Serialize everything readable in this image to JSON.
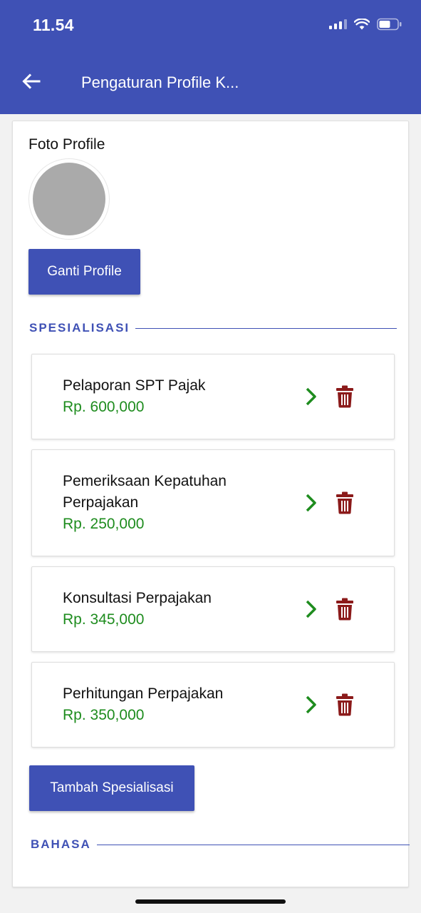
{
  "status_bar": {
    "time": "11.54"
  },
  "app_bar": {
    "title": "Pengaturan Profile K..."
  },
  "profile": {
    "photo_label": "Foto Profile",
    "change_button": "Ganti Profile"
  },
  "specializations": {
    "section_title": "SPESIALISASI",
    "items": [
      {
        "name": "Pelaporan SPT Pajak",
        "price": "Rp. 600,000"
      },
      {
        "name": "Pemeriksaan Kepatuhan Perpajakan",
        "price": "Rp. 250,000"
      },
      {
        "name": "Konsultasi Perpajakan",
        "price": "Rp. 345,000"
      },
      {
        "name": "Perhitungan Perpajakan",
        "price": "Rp. 350,000"
      }
    ],
    "add_button": "Tambah Spesialisasi"
  },
  "language": {
    "section_title": "BAHASA"
  },
  "colors": {
    "primary": "#3f51b5",
    "price": "#1e8c1e",
    "chevron": "#1e8c1e",
    "delete": "#8b1a1a"
  },
  "icons": {
    "back": "arrow-left-icon",
    "open": "chevron-right-icon",
    "delete": "trash-icon"
  }
}
